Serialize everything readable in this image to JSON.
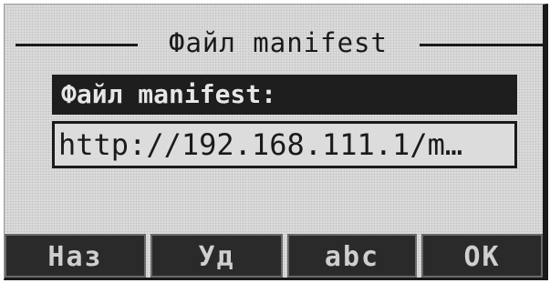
{
  "header": {
    "title": "Файл manifest"
  },
  "field": {
    "label": "Файл manifest:",
    "value": "http://192.168.111.1/m…"
  },
  "softkeys": [
    {
      "label": "Наз"
    },
    {
      "label": "Уд"
    },
    {
      "label": "abc"
    },
    {
      "label": "OK"
    }
  ],
  "colors": {
    "lcd_background": "#dcdcdc",
    "pixel_dark": "#1a1a1a",
    "softkey_background": "#2a2a2a"
  }
}
